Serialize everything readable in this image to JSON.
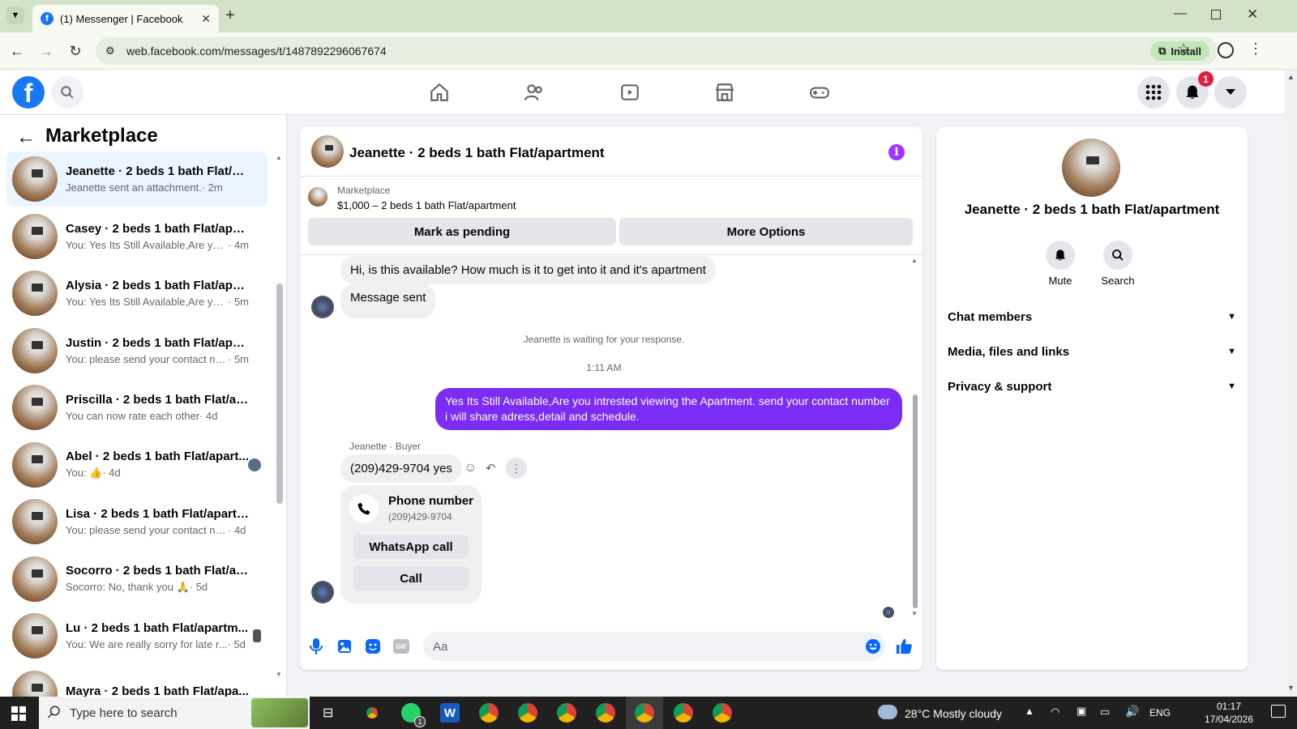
{
  "browser": {
    "tab_title": "(1) Messenger | Facebook",
    "url": "web.facebook.com/messages/t/1487892296067674",
    "install_label": "Install"
  },
  "fb": {
    "notifications_count": "1"
  },
  "left": {
    "title": "Marketplace",
    "conversations": [
      {
        "name": "Jeanette · 2 beds 1 bath Flat/apa...",
        "preview": "Jeanette sent an attachment.",
        "time": "· 2m",
        "active": true
      },
      {
        "name": "Casey · 2 beds 1 bath Flat/apart...",
        "preview": "You: Yes Its Still Available,Are you i...",
        "time": "· 4m"
      },
      {
        "name": "Alysia · 2 beds 1 bath Flat/apart...",
        "preview": "You: Yes Its Still Available,Are you i...",
        "time": "· 5m"
      },
      {
        "name": "Justin · 2 beds 1 bath Flat/apart...",
        "preview": "You: please send your contact nu...",
        "time": "· 5m"
      },
      {
        "name": "Priscilla · 2 beds 1 bath Flat/apar...",
        "preview": "You can now rate each other",
        "time": "· 4d"
      },
      {
        "name": "Abel · 2 beds 1 bath Flat/apart...",
        "preview": "You: 👍",
        "time": "· 4d"
      },
      {
        "name": "Lisa · 2 beds 1 bath Flat/apartme...",
        "preview": "You: please send your contact num...",
        "time": "· 4d"
      },
      {
        "name": "Socorro · 2 beds 1 bath Flat/apar...",
        "preview": "Socorro: No, thank you 🙏",
        "time": "· 5d"
      },
      {
        "name": "Lu · 2 beds 1 bath Flat/apartm...",
        "preview": "You: We are really sorry for late r...",
        "time": "· 5d"
      },
      {
        "name": "Mayra · 2 beds 1 bath Flat/apa...",
        "preview": "",
        "time": ""
      }
    ]
  },
  "chat": {
    "title": "Jeanette · 2 beds 1 bath Flat/apartment",
    "marketplace_label": "Marketplace",
    "listing": "$1,000 – 2 beds 1 bath Flat/apartment",
    "mark_pending": "Mark as pending",
    "more_options": "More Options",
    "msg_in_1": "Hi, is this available? How much is it to get into it and it's apartment",
    "msg_in_2": "Message sent",
    "waiting": "Jeanette is waiting for your response.",
    "timestamp": "1:11 AM",
    "msg_out": "Yes Its Still Available,Are you intrested viewing the Apartment. send your contact number i will share adress,detail and schedule.",
    "sender_meta": "Jeanette · Buyer",
    "msg_in_3": "(209)429-9704 yes",
    "card_title": "Phone number",
    "card_number": "(209)429-9704",
    "whatsapp_call": "WhatsApp call",
    "call": "Call",
    "input_placeholder": "Aa"
  },
  "right": {
    "name": "Jeanette · 2 beds 1 bath Flat/apartment",
    "mute": "Mute",
    "search": "Search",
    "sections": [
      "Chat members",
      "Media, files and links",
      "Privacy & support"
    ]
  },
  "taskbar": {
    "search_placeholder": "Type here to search",
    "weather": "28°C  Mostly cloudy",
    "lang": "ENG",
    "time": "01:17",
    "date": "17/04/2026",
    "whatsapp_badge": "1"
  },
  "colors": {
    "fb_blue": "#1877f2",
    "outgoing_bubble": "#7b2cf5",
    "info_icon": "#a033ff"
  }
}
